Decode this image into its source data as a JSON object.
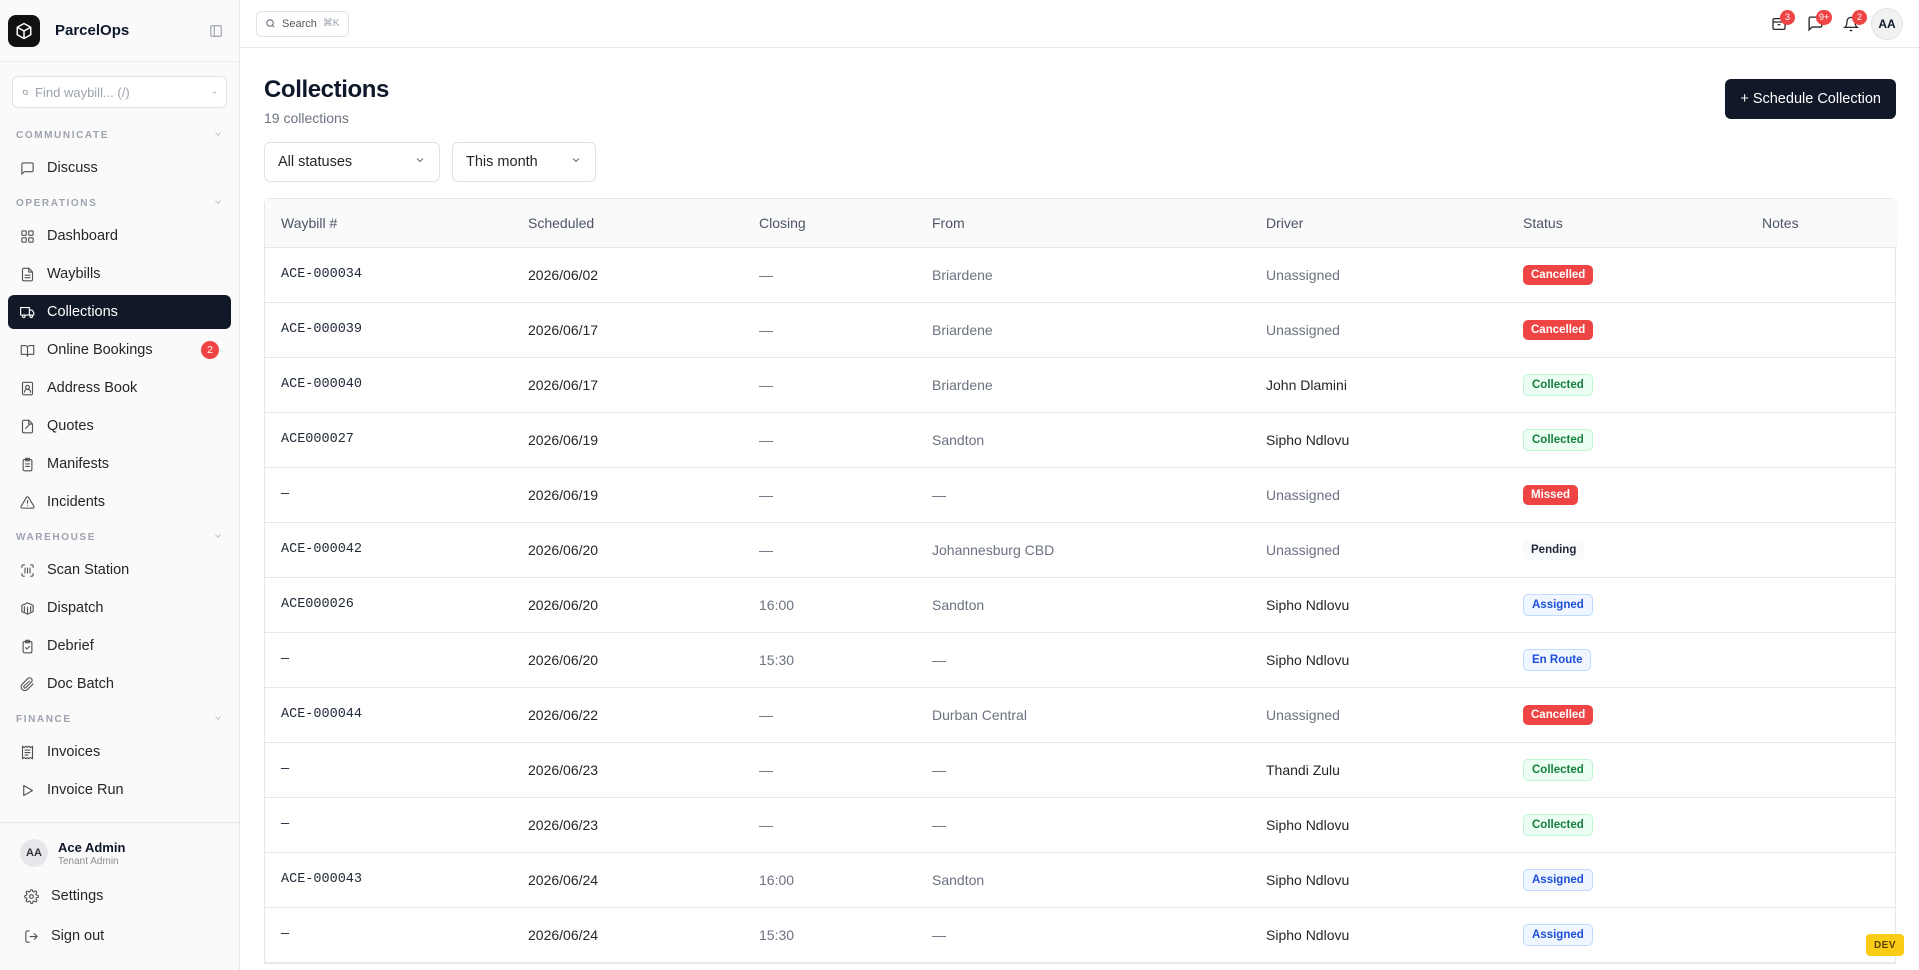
{
  "app": {
    "name": "ParcelOps"
  },
  "sidebar": {
    "search_placeholder": "Find waybill... (/)",
    "sections": [
      {
        "title": "COMMUNICATE",
        "items": [
          {
            "label": "Discuss",
            "icon": "message-square-icon"
          }
        ]
      },
      {
        "title": "OPERATIONS",
        "items": [
          {
            "label": "Dashboard",
            "icon": "layout-grid-icon"
          },
          {
            "label": "Waybills",
            "icon": "file-text-icon"
          },
          {
            "label": "Collections",
            "icon": "truck-icon",
            "active": true
          },
          {
            "label": "Online Bookings",
            "icon": "book-open-icon",
            "badge": "2"
          },
          {
            "label": "Address Book",
            "icon": "address-book-icon"
          },
          {
            "label": "Quotes",
            "icon": "file-quote-icon"
          },
          {
            "label": "Manifests",
            "icon": "clipboard-list-icon"
          },
          {
            "label": "Incidents",
            "icon": "alert-triangle-icon"
          }
        ]
      },
      {
        "title": "WAREHOUSE",
        "items": [
          {
            "label": "Scan Station",
            "icon": "scan-icon"
          },
          {
            "label": "Dispatch",
            "icon": "container-icon"
          },
          {
            "label": "Debrief",
            "icon": "clipboard-check-icon"
          },
          {
            "label": "Doc Batch",
            "icon": "paperclip-icon"
          }
        ]
      },
      {
        "title": "FINANCE",
        "items": [
          {
            "label": "Invoices",
            "icon": "receipt-icon"
          },
          {
            "label": "Invoice Run",
            "icon": "play-icon"
          }
        ]
      }
    ],
    "user": {
      "initials": "AA",
      "name": "Ace Admin",
      "role": "Tenant Admin"
    },
    "settings_label": "Settings",
    "signout_label": "Sign out"
  },
  "topbar": {
    "search_label": "Search",
    "search_shortcut": "⌘K",
    "badges": {
      "packages": "3",
      "messages": "9+",
      "notifications": "2"
    },
    "avatar_initials": "AA"
  },
  "page": {
    "title": "Collections",
    "subtitle": "19 collections",
    "primary_action": "+ Schedule Collection",
    "filters": {
      "status": "All statuses",
      "period": "This month"
    },
    "env_badge": "DEV"
  },
  "table": {
    "columns": [
      "Waybill #",
      "Scheduled",
      "Closing",
      "From",
      "Driver",
      "Status",
      "Notes"
    ],
    "rows": [
      {
        "waybill": "ACE-000034",
        "scheduled": "2026/06/02",
        "closing": "—",
        "from": "Briardene",
        "driver": "Unassigned",
        "status": "Cancelled",
        "notes": ""
      },
      {
        "waybill": "ACE-000039",
        "scheduled": "2026/06/17",
        "closing": "—",
        "from": "Briardene",
        "driver": "Unassigned",
        "status": "Cancelled",
        "notes": ""
      },
      {
        "waybill": "ACE-000040",
        "scheduled": "2026/06/17",
        "closing": "—",
        "from": "Briardene",
        "driver": "John Dlamini",
        "status": "Collected",
        "notes": ""
      },
      {
        "waybill": "ACE000027",
        "scheduled": "2026/06/19",
        "closing": "—",
        "from": "Sandton",
        "driver": "Sipho Ndlovu",
        "status": "Collected",
        "notes": ""
      },
      {
        "waybill": "—",
        "scheduled": "2026/06/19",
        "closing": "—",
        "from": "—",
        "driver": "Unassigned",
        "status": "Missed",
        "notes": ""
      },
      {
        "waybill": "ACE-000042",
        "scheduled": "2026/06/20",
        "closing": "—",
        "from": "Johannesburg CBD",
        "driver": "Unassigned",
        "status": "Pending",
        "notes": ""
      },
      {
        "waybill": "ACE000026",
        "scheduled": "2026/06/20",
        "closing": "16:00",
        "from": "Sandton",
        "driver": "Sipho Ndlovu",
        "status": "Assigned",
        "notes": ""
      },
      {
        "waybill": "—",
        "scheduled": "2026/06/20",
        "closing": "15:30",
        "from": "—",
        "driver": "Sipho Ndlovu",
        "status": "En Route",
        "notes": ""
      },
      {
        "waybill": "ACE-000044",
        "scheduled": "2026/06/22",
        "closing": "—",
        "from": "Durban Central",
        "driver": "Unassigned",
        "status": "Cancelled",
        "notes": ""
      },
      {
        "waybill": "—",
        "scheduled": "2026/06/23",
        "closing": "—",
        "from": "—",
        "driver": "Thandi Zulu",
        "status": "Collected",
        "notes": ""
      },
      {
        "waybill": "—",
        "scheduled": "2026/06/23",
        "closing": "—",
        "from": "—",
        "driver": "Sipho Ndlovu",
        "status": "Collected",
        "notes": ""
      },
      {
        "waybill": "ACE-000043",
        "scheduled": "2026/06/24",
        "closing": "16:00",
        "from": "Sandton",
        "driver": "Sipho Ndlovu",
        "status": "Assigned",
        "notes": ""
      },
      {
        "waybill": "—",
        "scheduled": "2026/06/24",
        "closing": "15:30",
        "from": "—",
        "driver": "Sipho Ndlovu",
        "status": "Assigned",
        "notes": ""
      }
    ]
  },
  "colors": {
    "primary": "#111827",
    "danger": "#ef4444",
    "success": "#15803d",
    "info": "#1d4ed8",
    "dev": "#facc15"
  }
}
